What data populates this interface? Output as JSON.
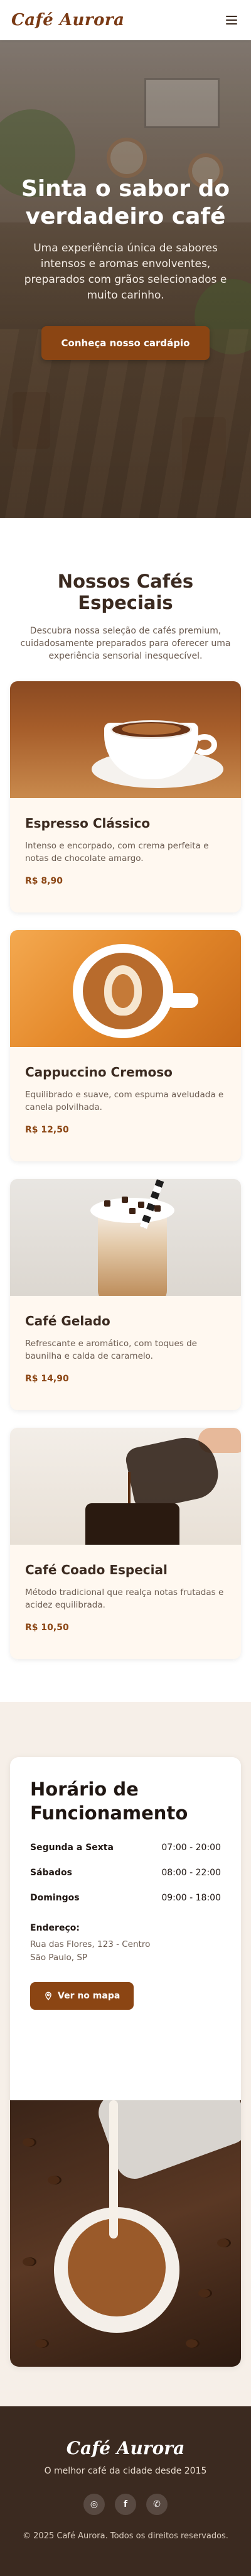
{
  "header": {
    "brand": "Café Aurora",
    "menu_icon": "hamburger-menu-icon"
  },
  "hero": {
    "title": "Sinta o sabor do verdadeiro café",
    "text": "Uma experiência única de sabores intensos e aromas envolventes, preparados com grãos selecionados e muito carinho.",
    "button_label": "Conheça nosso cardápio"
  },
  "products": {
    "title": "Nossos Cafés Especiais",
    "subtitle": "Descubra nossa seleção de cafés premium, cuidadosamente preparados para oferecer uma experiência sensorial inesquecível.",
    "items": [
      {
        "name": "Espresso Clássico",
        "description": "Intenso e encorpado, com crema perfeita e notas de chocolate amargo.",
        "price": "R$ 8,90"
      },
      {
        "name": "Cappuccino Cremoso",
        "description": "Equilibrado e suave, com espuma aveludada e canela polvilhada.",
        "price": "R$ 12,50"
      },
      {
        "name": "Café Gelado",
        "description": "Refrescante e aromático, com toques de baunilha e calda de caramelo.",
        "price": "R$ 14,90"
      },
      {
        "name": "Café Coado Especial",
        "description": "Método tradicional que realça notas frutadas e acidez equilibrada.",
        "price": "R$ 10,50"
      }
    ]
  },
  "hours": {
    "title": "Horário de Funcionamento",
    "rows": [
      {
        "day": "Segunda a Sexta",
        "time": "07:00 - 20:00"
      },
      {
        "day": "Sábados",
        "time": "08:00 - 22:00"
      },
      {
        "day": "Domingos",
        "time": "09:00 - 18:00"
      }
    ],
    "address_label": "Endereço:",
    "address_line1": "Rua das Flores, 123 - Centro",
    "address_line2": "São Paulo, SP",
    "map_button_label": "Ver no mapa",
    "map_icon": "location-pin-icon"
  },
  "footer": {
    "brand": "Café Aurora",
    "tagline": "O melhor café da cidade desde 2015",
    "socials": [
      {
        "icon": "instagram-icon",
        "glyph": "◎"
      },
      {
        "icon": "facebook-icon",
        "glyph": "f"
      },
      {
        "icon": "whatsapp-icon",
        "glyph": "✆"
      }
    ],
    "copyright": "© 2025 Café Aurora. Todos os direitos reservados."
  },
  "colors": {
    "brand": "#7a3a15",
    "accent": "#8b4513",
    "footer_bg": "#3b2a20",
    "section_bg": "#f6efe8"
  }
}
